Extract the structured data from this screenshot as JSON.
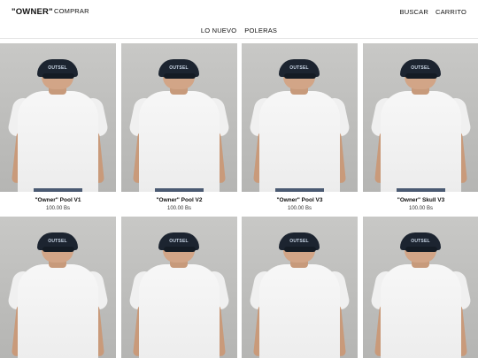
{
  "header": {
    "logo": "\"OWNER\"",
    "shop_label": "COMPRAR",
    "search_label": "BUSCAR",
    "cart_label": "CARRITO"
  },
  "subnav": {
    "items": [
      "LO NUEVO",
      "POLERAS"
    ]
  },
  "products": [
    {
      "name": "\"Owner\" Pool V1",
      "price": "100.00 Bs"
    },
    {
      "name": "\"Owner\" Pool V2",
      "price": "100.00 Bs"
    },
    {
      "name": "\"Owner\" Pool V3",
      "price": "100.00 Bs"
    },
    {
      "name": "\"Owner\" Skull V3",
      "price": "100.00 Bs"
    },
    {
      "name": "",
      "price": ""
    },
    {
      "name": "",
      "price": ""
    },
    {
      "name": "",
      "price": ""
    },
    {
      "name": "",
      "price": ""
    }
  ],
  "cap_text": "OUTSEL"
}
